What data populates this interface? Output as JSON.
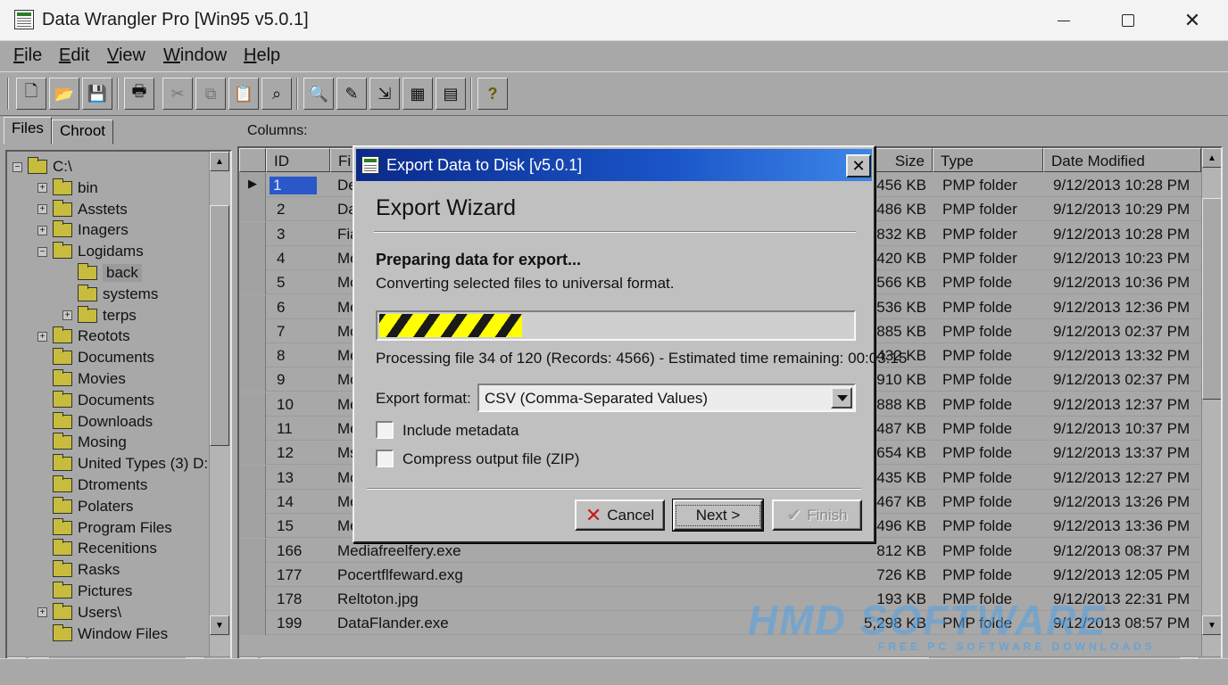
{
  "window": {
    "title": "Data Wrangler Pro [Win95 v5.0.1]",
    "controls": {
      "minimize": "minimize-icon",
      "maximize": "maximize-icon",
      "close": "✕"
    }
  },
  "menu": [
    {
      "accel": "F",
      "rest": "ile"
    },
    {
      "accel": "E",
      "rest": "dit"
    },
    {
      "accel": "V",
      "rest": "iew"
    },
    {
      "accel": "W",
      "rest": "indow"
    },
    {
      "accel": "H",
      "rest": "elp"
    }
  ],
  "toolbar": {
    "buttons": [
      {
        "icon": "new-file-icon",
        "glyph": "🗋"
      },
      {
        "icon": "open-folder-icon",
        "glyph": "📂"
      },
      {
        "icon": "save-icon",
        "glyph": "💾"
      },
      {
        "icon": "print-icon",
        "glyph": "🖶"
      },
      {
        "icon": "cut-icon",
        "glyph": "✂"
      },
      {
        "icon": "copy-icon",
        "glyph": "⧉"
      },
      {
        "icon": "paste-icon",
        "glyph": "📋"
      },
      {
        "icon": "find-replace-icon",
        "glyph": "⌕"
      },
      {
        "icon": "search-icon",
        "glyph": "🔍"
      },
      {
        "icon": "edit-record-icon",
        "glyph": "✎"
      },
      {
        "icon": "export-icon",
        "glyph": "⇲"
      },
      {
        "icon": "grid-view-icon",
        "glyph": "▦"
      },
      {
        "icon": "columns-icon",
        "glyph": "▤"
      },
      {
        "icon": "help-icon",
        "glyph": "?"
      }
    ]
  },
  "left_panel": {
    "tabs": [
      "Files",
      "Chroot"
    ],
    "tree": [
      {
        "label": "C:\\",
        "expander": "−"
      },
      {
        "label": "bin",
        "expander": "+"
      },
      {
        "label": "Asstets",
        "expander": "+"
      },
      {
        "label": "Inagers",
        "expander": "+"
      },
      {
        "label": "Logidams",
        "expander": "−"
      },
      {
        "label": "back",
        "expander": ""
      },
      {
        "label": "systems",
        "expander": ""
      },
      {
        "label": "terps",
        "expander": "+"
      },
      {
        "label": "Reotots",
        "expander": "+"
      },
      {
        "label": "Documents",
        "expander": ""
      },
      {
        "label": "Movies",
        "expander": ""
      },
      {
        "label": "Documents",
        "expander": ""
      },
      {
        "label": "Downloads",
        "expander": ""
      },
      {
        "label": "Mosing",
        "expander": ""
      },
      {
        "label": "United Types (3) D:",
        "expander": ""
      },
      {
        "label": "Dtroments",
        "expander": ""
      },
      {
        "label": "Polaters",
        "expander": ""
      },
      {
        "label": "Program Files",
        "expander": ""
      },
      {
        "label": "Recenitions",
        "expander": ""
      },
      {
        "label": "Rasks",
        "expander": ""
      },
      {
        "label": "Pictures",
        "expander": ""
      },
      {
        "label": "Users\\",
        "expander": "+"
      },
      {
        "label": "Window Files",
        "expander": ""
      }
    ]
  },
  "list": {
    "columns_label": "Columns:",
    "headers": {
      "id": "ID",
      "name": "Fi",
      "size": "Size",
      "type": "Type",
      "date": "Date Modified"
    },
    "rows": [
      {
        "id": "1",
        "name": "De",
        "size": "456 KB",
        "type": "PMP folder",
        "date": "9/12/2013 10:28 PM"
      },
      {
        "id": "2",
        "name": "Da",
        "size": "486 KB",
        "type": "PMP folder",
        "date": "9/12/2013 10:29 PM"
      },
      {
        "id": "3",
        "name": "Fia",
        "size": "832 KB",
        "type": "PMP folder",
        "date": "9/12/2013 10:28 PM"
      },
      {
        "id": "4",
        "name": "Me",
        "size": "420 KB",
        "type": "PMP folder",
        "date": "9/12/2013 10:23 PM"
      },
      {
        "id": "5",
        "name": "Mo",
        "size": "566 KB",
        "type": "PMP folde",
        "date": "9/12/2013 10:36 PM"
      },
      {
        "id": "6",
        "name": "Me",
        "size": "536 KB",
        "type": "PMP folde",
        "date": "9/12/2013 12:36 PM"
      },
      {
        "id": "7",
        "name": "Mo",
        "size": "885 KB",
        "type": "PMP folde",
        "date": "9/12/2013 02:37 PM"
      },
      {
        "id": "8",
        "name": "Me",
        "size": "432 KB",
        "type": "PMP folde",
        "date": "9/12/2013 13:32 PM"
      },
      {
        "id": "9",
        "name": "Mo",
        "size": "910 KB",
        "type": "PMP folde",
        "date": "9/12/2013 02:37 PM"
      },
      {
        "id": "10",
        "name": "Me",
        "size": "888 KB",
        "type": "PMP folde",
        "date": "9/12/2013 12:37 PM"
      },
      {
        "id": "11",
        "name": "Me",
        "size": "487 KB",
        "type": "PMP folde",
        "date": "9/12/2013 10:37 PM"
      },
      {
        "id": "12",
        "name": "Ms",
        "size": "654 KB",
        "type": "PMP folde",
        "date": "9/12/2013 13:37 PM"
      },
      {
        "id": "13",
        "name": "Mo",
        "size": "435 KB",
        "type": "PMP folde",
        "date": "9/12/2013 12:27 PM"
      },
      {
        "id": "14",
        "name": "Me",
        "size": "467 KB",
        "type": "PMP folde",
        "date": "9/12/2013 13:26 PM"
      },
      {
        "id": "15",
        "name": "Me",
        "size": "496 KB",
        "type": "PMP folde",
        "date": "9/12/2013 13:36 PM"
      },
      {
        "id": "166",
        "name": "Mediafreelfery.exe",
        "size": "812 KB",
        "type": "PMP folde",
        "date": "9/12/2013 08:37 PM"
      },
      {
        "id": "177",
        "name": "Pocertflfeward.exg",
        "size": "726 KB",
        "type": "PMP folde",
        "date": "9/12/2013 12:05 PM"
      },
      {
        "id": "178",
        "name": "Reltoton.jpg",
        "size": "193 KB",
        "type": "PMP folde",
        "date": "9/12/2013 22:31 PM"
      },
      {
        "id": "199",
        "name": "DataFlander.exe",
        "size": "5,298 KB",
        "type": "PMP folde",
        "date": "9/12/2013 08:57 PM"
      }
    ]
  },
  "watermark": {
    "main": "HMD SOFTWARE",
    "sub": "FREE PC SOFTWARE DOWNLOADS"
  },
  "dialog": {
    "title": "Export Data to Disk [v5.0.1]",
    "close": "✕",
    "heading": "Export Wizard",
    "status_title": "Preparing data for export...",
    "status_detail": "Converting selected files to universal format.",
    "progress_fraction": 0.3,
    "progress_text": "Processing file 34 of 120 (Records: 4566) - Estimated time remaining: 00:03:15",
    "format_label": "Export format:",
    "format_value": "CSV (Comma-Separated Values)",
    "include_metadata": {
      "label": "Include metadata",
      "checked": false
    },
    "compress": {
      "label": "Compress output file (ZIP)",
      "checked": false
    },
    "buttons": {
      "cancel": "Cancel",
      "next": "Next >",
      "finish": "Finish"
    },
    "colors": {
      "title_start": "#0a2a8a",
      "title_end": "#3d86e8",
      "progress_stripe_a": "#ffff00",
      "progress_stripe_b": "#1a1a1a",
      "cancel_icon": "#c81818"
    }
  }
}
